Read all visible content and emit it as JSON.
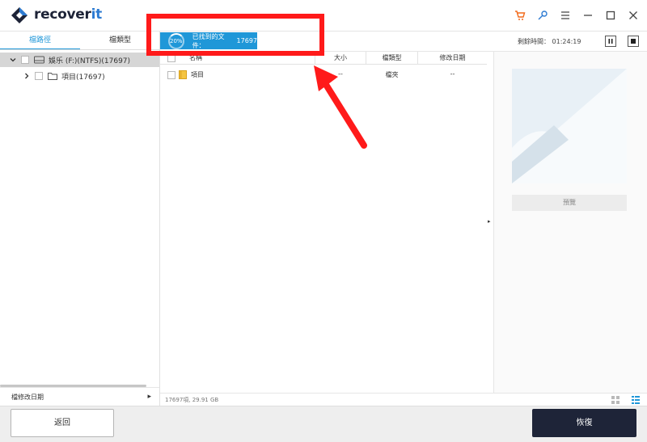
{
  "app": {
    "logo_prefix": "recover",
    "logo_suffix": "it"
  },
  "titlebar": {
    "icons": [
      "cart-icon",
      "key-icon",
      "menu-icon",
      "minimize-icon",
      "maximize-icon",
      "close-icon"
    ]
  },
  "left_panel": {
    "tabs": [
      "檔路徑",
      "檔類型"
    ],
    "tree": [
      {
        "label": "娛乐 (F:)(NTFS)(17697)"
      },
      {
        "label": "項目(17697)"
      }
    ],
    "filter_label": "檔修改日期"
  },
  "scan": {
    "percent": "20%",
    "found_label": "已找到的文件：",
    "found_count": "17697",
    "remaining_label": "剩餘時間：",
    "remaining_time": "01:24:19"
  },
  "file_list": {
    "columns": [
      "名稱",
      "大小",
      "檔類型",
      "修改日期"
    ],
    "rows": [
      {
        "name": "項目",
        "size": "--",
        "type": "檔夾",
        "modified": "--"
      }
    ]
  },
  "preview": {
    "button_label": "預覽"
  },
  "status": {
    "summary": "17697項, 29.91 GB"
  },
  "actions": {
    "back_label": "返回",
    "recover_label": "恢復"
  },
  "colors": {
    "accent": "#1f97d8",
    "dark_button": "#1e2438",
    "annotation_red": "#ff1a1a"
  }
}
